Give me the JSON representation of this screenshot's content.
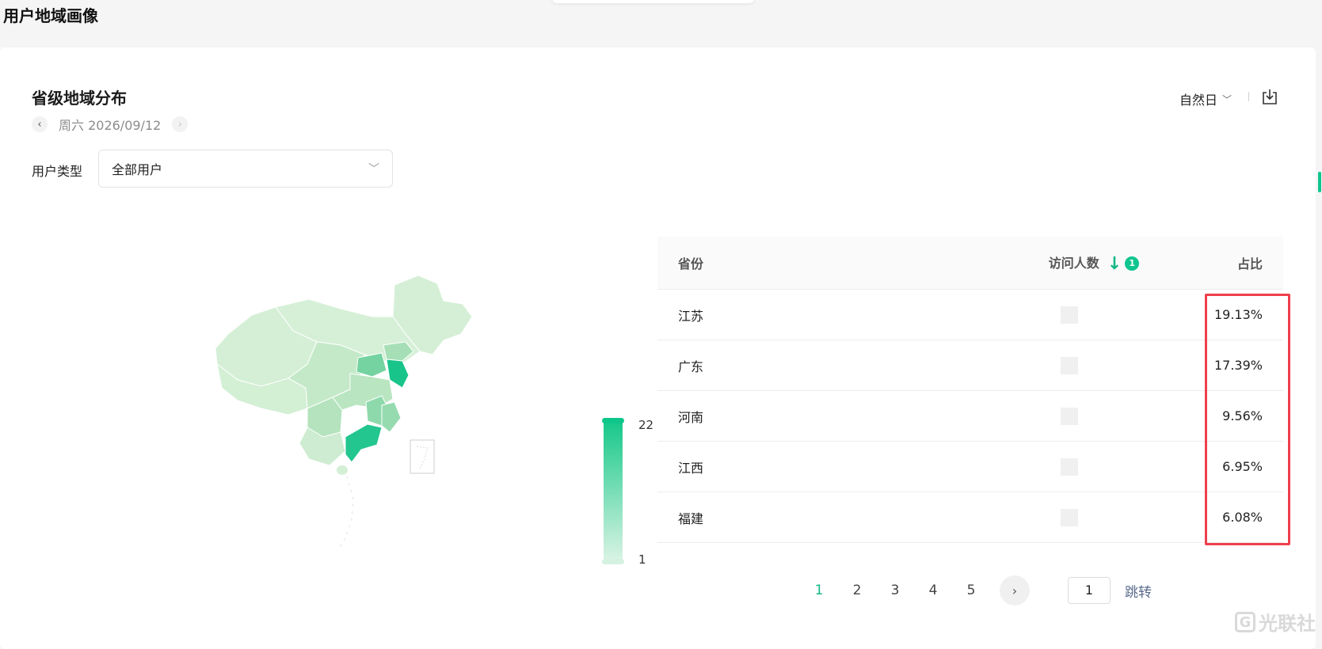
{
  "page": {
    "title": "用户地域画像"
  },
  "section": {
    "title": "省级地域分布",
    "date": "周六 2026/09/12",
    "period": "自然日",
    "filter_label": "用户类型",
    "filter_value": "全部用户"
  },
  "legend": {
    "max": "22",
    "min": "1"
  },
  "table": {
    "headers": {
      "province": "省份",
      "visits": "访问人数",
      "ratio": "占比",
      "sort_badge": "1"
    },
    "rows": [
      {
        "province": "江苏",
        "ratio": "19.13%"
      },
      {
        "province": "广东",
        "ratio": "17.39%"
      },
      {
        "province": "河南",
        "ratio": "9.56%"
      },
      {
        "province": "江西",
        "ratio": "6.95%"
      },
      {
        "province": "福建",
        "ratio": "6.08%"
      }
    ]
  },
  "pagination": {
    "pages": [
      "1",
      "2",
      "3",
      "4",
      "5"
    ],
    "current": "1",
    "jump_value": "1",
    "jump_label": "跳转"
  },
  "watermark": {
    "logo": "G",
    "text": "光联社"
  },
  "colors": {
    "accent": "#12b886",
    "highlight": "#f03f4c",
    "map_light": "#d4efd5",
    "map_dark": "#18c48a"
  },
  "icons": {
    "prev": "chevron-left-icon",
    "next": "chevron-right-icon",
    "export": "export-icon",
    "sort": "arrow-down-icon"
  }
}
